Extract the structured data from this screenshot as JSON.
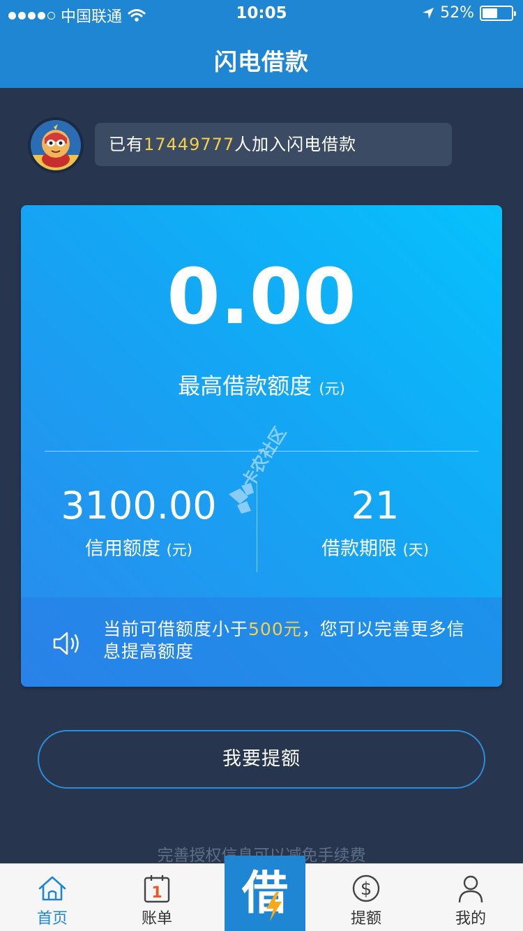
{
  "status_bar": {
    "carrier": "中国联通",
    "time": "10:05",
    "battery": "52%",
    "battery_level": 0.52
  },
  "nav": {
    "title": "闪电借款"
  },
  "join": {
    "prefix": "已有",
    "count": "17449777",
    "suffix": "人加入闪电借款"
  },
  "card": {
    "max_amount": "0.00",
    "max_label": "最高借款额度",
    "max_unit": "(元)",
    "credit_value": "3100.00",
    "credit_label": "信用额度",
    "credit_unit": "(元)",
    "term_value": "21",
    "term_label": "借款期限",
    "term_unit": "(天)",
    "notice_part1": "当前可借额度小于",
    "notice_highlight": "500元",
    "notice_part2": "，您可以完善更多信息提高额度"
  },
  "watermark": {
    "text": "卡农社区"
  },
  "raise_button": "我要提额",
  "hint": "完善授权信息可以减免手续费",
  "tabs": [
    {
      "label": "首页",
      "icon": "home-icon",
      "active": true
    },
    {
      "label": "账单",
      "icon": "calendar-icon"
    },
    {
      "label": "借",
      "icon": "borrow-icon"
    },
    {
      "label": "提额",
      "icon": "dollar-icon"
    },
    {
      "label": "我的",
      "icon": "user-icon"
    }
  ],
  "colors": {
    "primary": "#1f86d3",
    "background": "#27364e",
    "highlight": "#f7d046"
  }
}
